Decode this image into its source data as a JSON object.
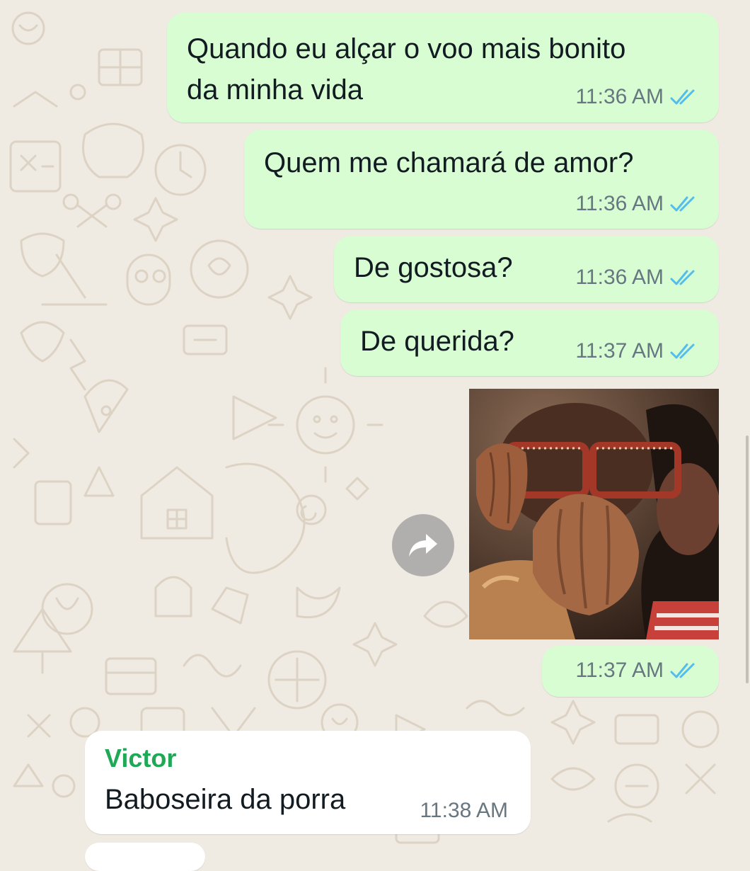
{
  "messages": [
    {
      "id": "m1",
      "direction": "out",
      "text_lines": [
        "Quando eu alçar o voo mais bonito",
        "da minha vida"
      ],
      "time": "11:36 AM",
      "status": "read"
    },
    {
      "id": "m2",
      "direction": "out",
      "text": "Quem me chamará de amor?",
      "time": "11:36 AM",
      "status": "read"
    },
    {
      "id": "m3",
      "direction": "out",
      "text": "De gostosa?",
      "time": "11:36 AM",
      "status": "read"
    },
    {
      "id": "m4",
      "direction": "out",
      "text": "De querida?",
      "time": "11:37 AM",
      "status": "read"
    },
    {
      "id": "m5",
      "direction": "out",
      "type": "image",
      "image": "person-crying-with-glasses-photo",
      "time": "11:37 AM",
      "status": "read"
    },
    {
      "id": "m6",
      "direction": "in",
      "sender": "Victor",
      "text": "Baboseira da porra",
      "time": "11:38 AM"
    }
  ],
  "icons": {
    "read_receipt": "double-check-icon",
    "forward": "forward-arrow-icon"
  },
  "colors": {
    "outgoing_bubble": "#d9fdd3",
    "incoming_bubble": "#ffffff",
    "chat_background": "#efeae2",
    "read_tick": "#53bdeb",
    "sender_name": "#1fa855",
    "meta_text": "#667781"
  }
}
